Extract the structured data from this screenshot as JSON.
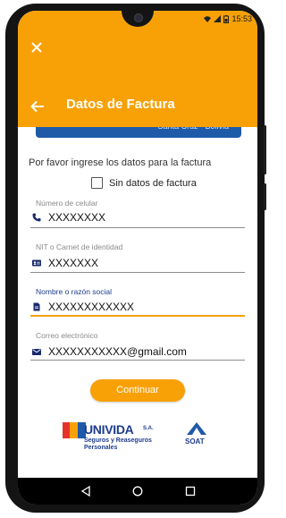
{
  "status_bar": {
    "time": "15:53"
  },
  "header": {
    "title": "Datos de Factura"
  },
  "card": {
    "location": "Santa Cruz - Bolivia"
  },
  "form": {
    "prompt": "Por favor ingrese los datos para la factura",
    "no_invoice_checkbox": {
      "label": "Sin datos de factura",
      "checked": false
    },
    "fields": [
      {
        "label": "Número de celular",
        "value": "XXXXXXXX",
        "icon": "phone-icon"
      },
      {
        "label": "NIT o Carnet de identidad",
        "value": "XXXXXXX",
        "icon": "id-card-icon"
      },
      {
        "label": "Nombre o razón social",
        "value": "XXXXXXXXXXXX",
        "icon": "document-icon",
        "focused": true
      },
      {
        "label": "Correo electrónico",
        "value": "XXXXXXXXXXX@gmail.com",
        "icon": "mail-icon"
      }
    ],
    "submit_label": "Continuar"
  },
  "logos": {
    "unividad_name": "UNIVIDA",
    "unividad_suffix": "S.A.",
    "unividad_tagline_1": "Seguros y Reaseguros",
    "unividad_tagline_2": "Personales",
    "soat": "SOAT"
  },
  "colors": {
    "accent": "#f7a107",
    "card_blue": "#1e5aa8"
  }
}
